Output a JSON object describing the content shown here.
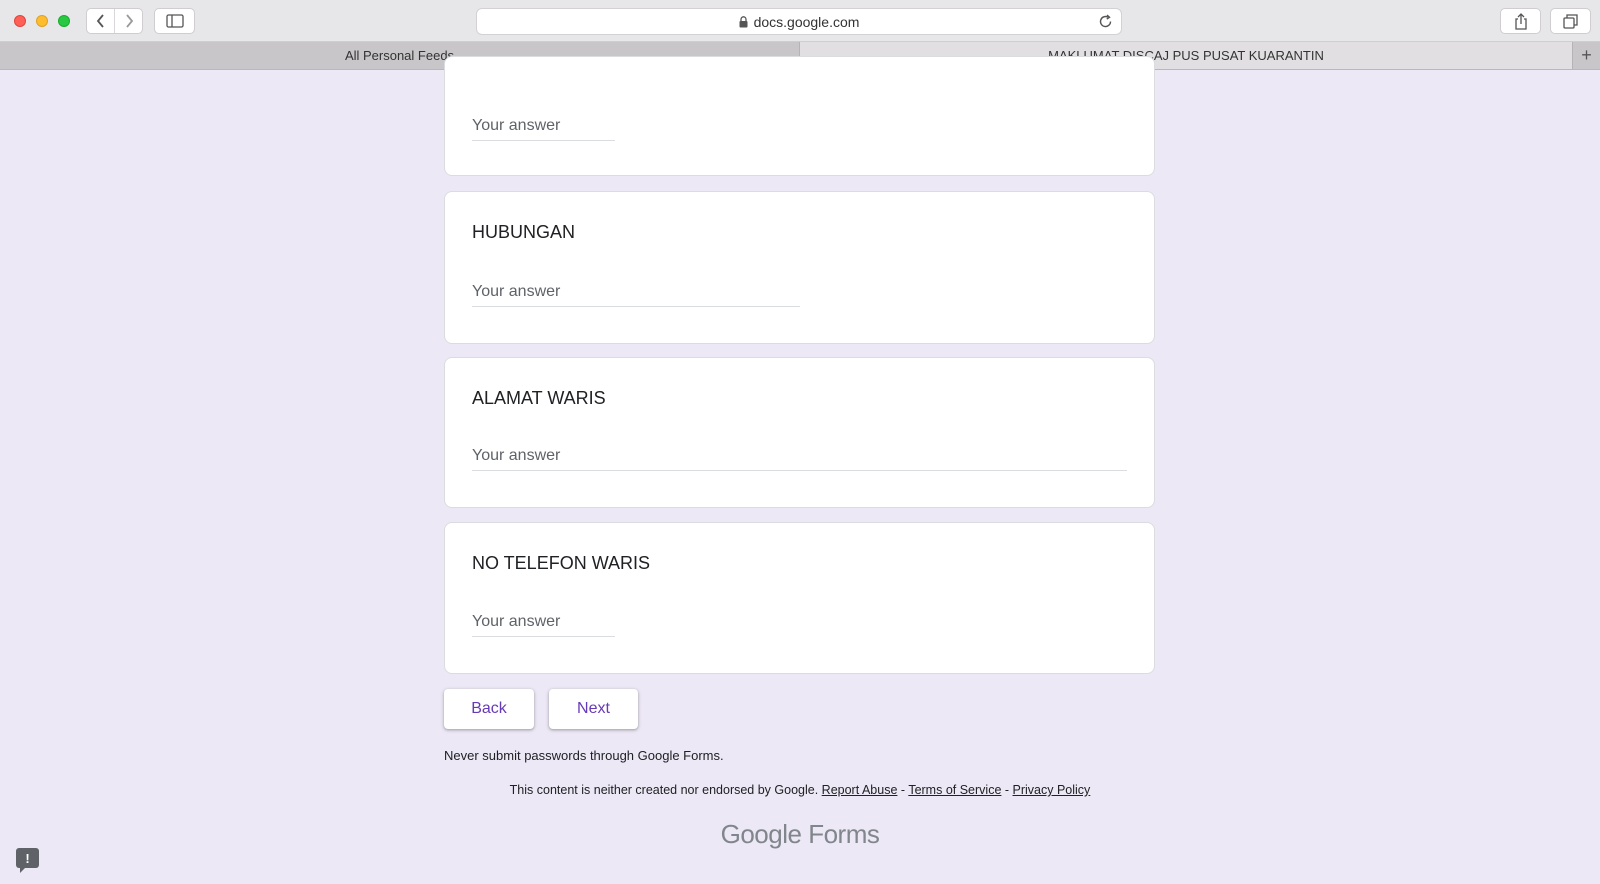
{
  "browser": {
    "url": "docs.google.com",
    "tabs": [
      {
        "label": "All Personal Feeds"
      },
      {
        "label": "MAKLUMAT DISCAJ PUS PUSAT KUARANTIN"
      }
    ],
    "new_tab_label": "+"
  },
  "form": {
    "questions": [
      {
        "title": "",
        "answer_placeholder": "Your answer"
      },
      {
        "title": "HUBUNGAN",
        "answer_placeholder": "Your answer"
      },
      {
        "title": "ALAMAT WARIS",
        "answer_placeholder": "Your answer"
      },
      {
        "title": "NO TELEFON WARIS",
        "answer_placeholder": "Your answer"
      }
    ],
    "back_label": "Back",
    "next_label": "Next",
    "accent_color": "#673ab7"
  },
  "footer": {
    "warning": "Never submit passwords through Google Forms.",
    "disclaimer": "This content is neither created nor endorsed by Google.",
    "report_abuse": "Report Abuse",
    "separator": " - ",
    "terms": "Terms of Service",
    "privacy": "Privacy Policy",
    "brand_google": "Google",
    "brand_forms": "Forms"
  },
  "feedback_icon_label": "!"
}
